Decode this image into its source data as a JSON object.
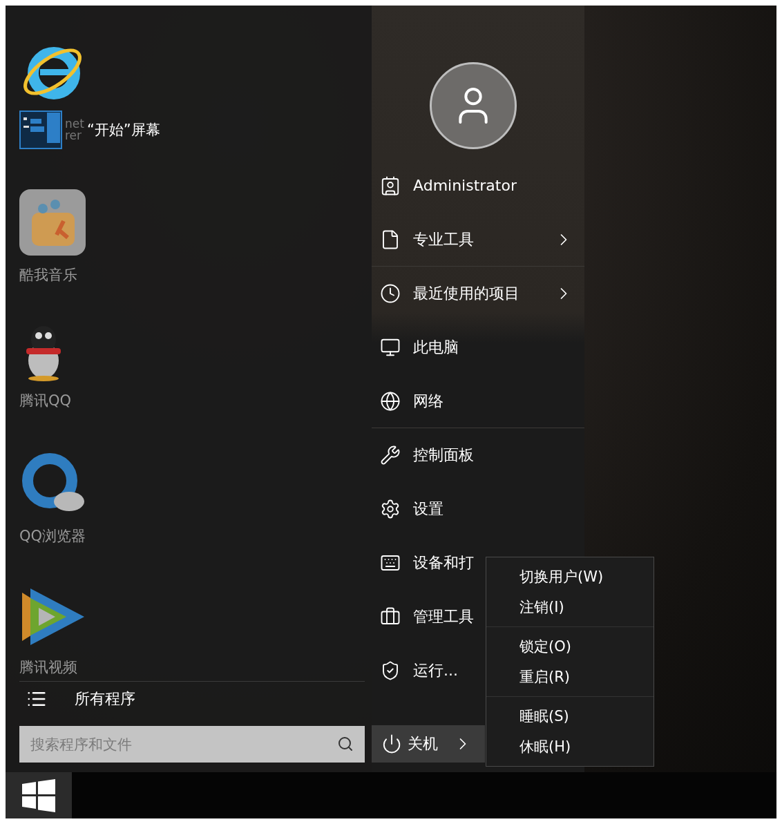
{
  "pinned_tiles": [
    {
      "fragments": [
        "net",
        "rer"
      ]
    },
    {
      "label": "酷我音乐"
    },
    {
      "label": "腾讯QQ"
    },
    {
      "label": "QQ浏览器"
    },
    {
      "label": "腾讯视频"
    }
  ],
  "start_screen_link": {
    "label": "“开始”屏幕"
  },
  "all_programs": {
    "label": "所有程序"
  },
  "search": {
    "placeholder": "搜索程序和文件"
  },
  "user_menu": [
    {
      "label": "Administrator",
      "arrow": false,
      "divider_after": false
    },
    {
      "label": "专业工具",
      "arrow": true,
      "divider_after": true
    },
    {
      "label": "最近使用的项目",
      "arrow": true,
      "divider_after": false
    },
    {
      "label": "此电脑",
      "arrow": false,
      "divider_after": false
    },
    {
      "label": "网络",
      "arrow": false,
      "divider_after": true
    },
    {
      "label": "控制面板",
      "arrow": false,
      "divider_after": false
    },
    {
      "label": "设置",
      "arrow": false,
      "divider_after": false
    },
    {
      "label": "设备和打",
      "arrow": false,
      "divider_after": false
    },
    {
      "label": "管理工具",
      "arrow": false,
      "divider_after": false
    },
    {
      "label": "运行...",
      "arrow": false,
      "divider_after": false
    }
  ],
  "shutdown_button": {
    "label": "关机",
    "expanded": true
  },
  "power_menu": [
    [
      "切换用户(W)",
      "注销(I)"
    ],
    [
      "锁定(O)",
      "重启(R)"
    ],
    [
      "睡眠(S)",
      "休眠(H)"
    ]
  ]
}
